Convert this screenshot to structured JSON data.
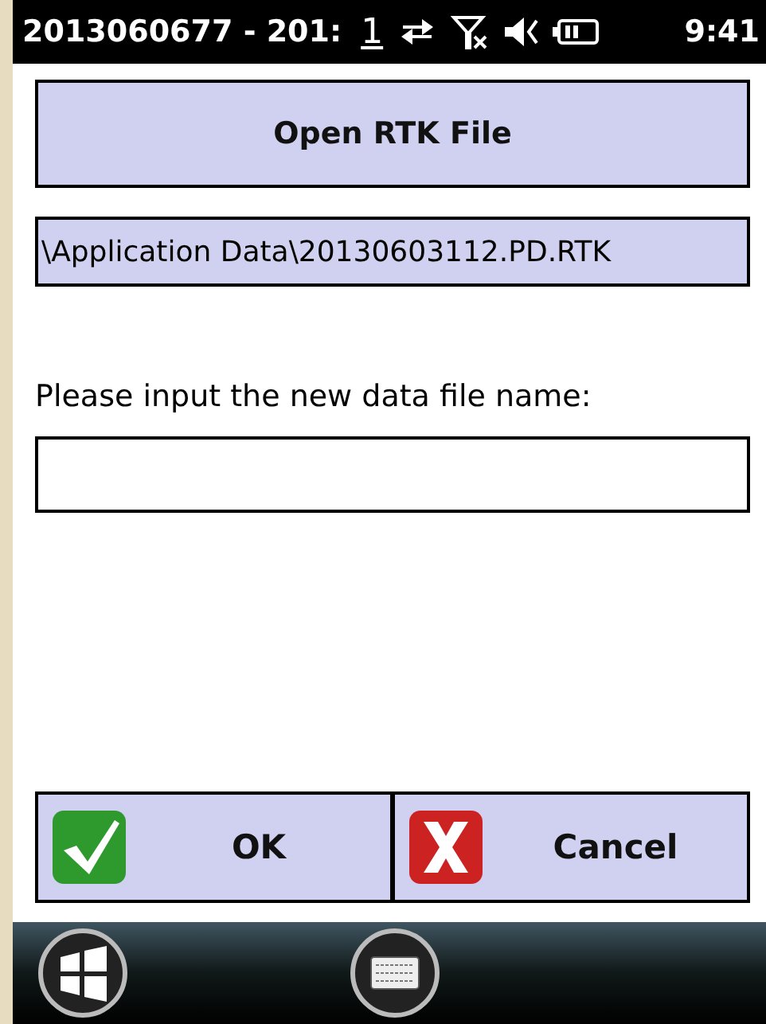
{
  "status_bar": {
    "title": "2013060677 - 201:",
    "indicator": "1",
    "time": "9:41"
  },
  "open_button": {
    "label": "Open RTK File"
  },
  "file_path": {
    "value": "\\Application Data\\20130603112.PD.RTK"
  },
  "prompt": {
    "label": "Please input the new data file name:"
  },
  "buttons": [
    {
      "kind": "ok",
      "label": "OK"
    },
    {
      "kind": "cancel",
      "label": "Cancel"
    }
  ]
}
